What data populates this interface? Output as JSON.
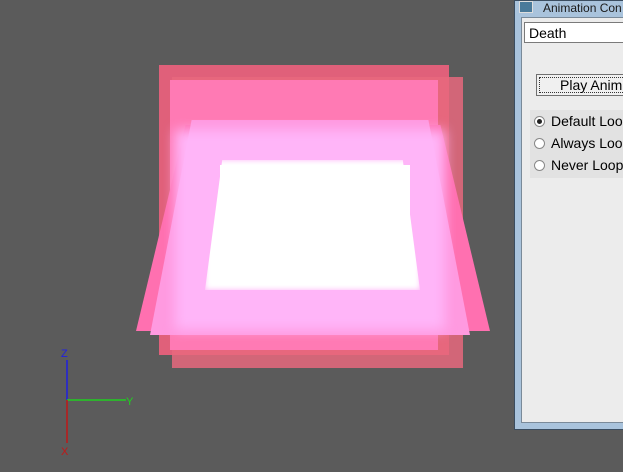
{
  "viewport": {
    "axes": {
      "z": "Z",
      "y": "Y",
      "x": "X"
    },
    "colors": {
      "z": "#2020e0",
      "y": "#20d020",
      "x": "#c01818",
      "mesh_outer": "#e0607a",
      "mesh_inner": "#ff70b0",
      "glow": "#ffffff"
    }
  },
  "window": {
    "title": "Animation Con",
    "animation_select": "Death",
    "play_button": "Play Anim",
    "loop_options": [
      {
        "label": "Default Loo",
        "selected": true
      },
      {
        "label": "Always Loo",
        "selected": false
      },
      {
        "label": "Never Loop",
        "selected": false
      }
    ]
  }
}
